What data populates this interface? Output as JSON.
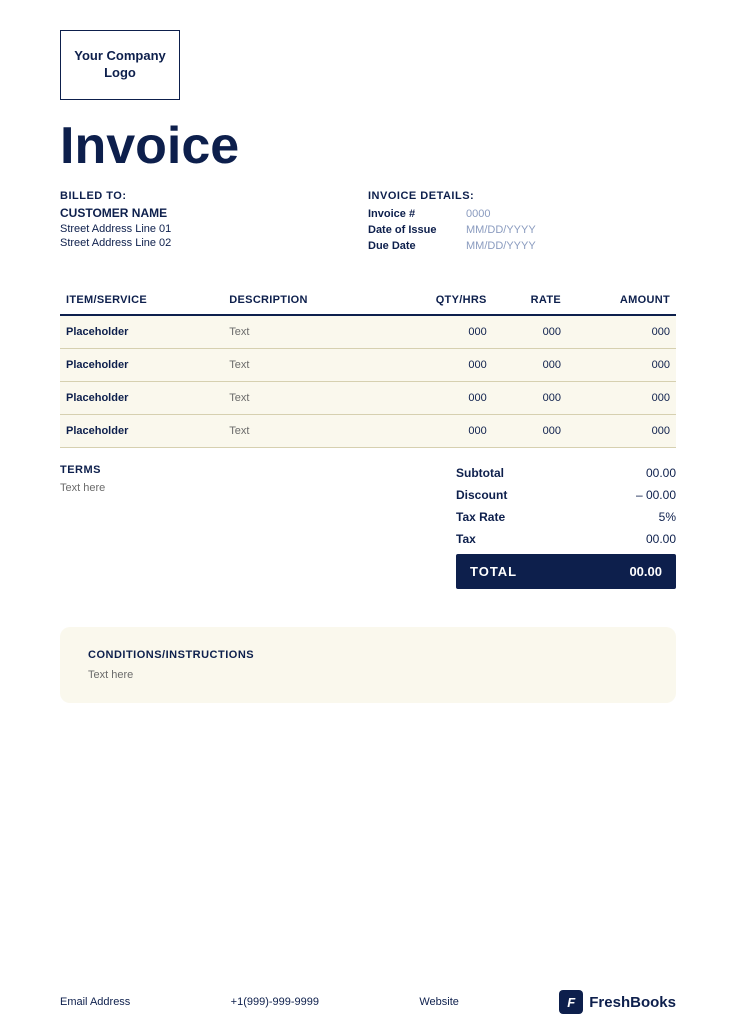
{
  "logo": {
    "text": "Your Company Logo"
  },
  "title": "Invoice",
  "billed_to": {
    "label": "BILLED TO:",
    "customer_name": "CUSTOMER NAME",
    "address_line1": "Street Address Line 01",
    "address_line2": "Street Address Line 02"
  },
  "invoice_details": {
    "label": "INVOICE DETAILS:",
    "rows": [
      {
        "key": "Invoice #",
        "value": "0000"
      },
      {
        "key": "Date of Issue",
        "value": "MM/DD/YYYY"
      },
      {
        "key": "Due Date",
        "value": "MM/DD/YYYY"
      }
    ]
  },
  "table": {
    "headers": [
      "ITEM/SERVICE",
      "DESCRIPTION",
      "QTY/HRS",
      "RATE",
      "AMOUNT"
    ],
    "rows": [
      {
        "item": "Placeholder",
        "desc": "Text",
        "qty": "000",
        "rate": "000",
        "amount": "000"
      },
      {
        "item": "Placeholder",
        "desc": "Text",
        "qty": "000",
        "rate": "000",
        "amount": "000"
      },
      {
        "item": "Placeholder",
        "desc": "Text",
        "qty": "000",
        "rate": "000",
        "amount": "000"
      },
      {
        "item": "Placeholder",
        "desc": "Text",
        "qty": "000",
        "rate": "000",
        "amount": "000"
      }
    ]
  },
  "terms": {
    "label": "TERMS",
    "text": "Text here"
  },
  "totals": {
    "subtotal_label": "Subtotal",
    "subtotal_value": "00.00",
    "discount_label": "Discount",
    "discount_value": "– 00.00",
    "tax_rate_label": "Tax Rate",
    "tax_rate_value": "5%",
    "tax_label": "Tax",
    "tax_value": "00.00",
    "total_label": "TOTAL",
    "total_value": "00.00"
  },
  "conditions": {
    "label": "CONDITIONS/INSTRUCTIONS",
    "text": "Text here"
  },
  "footer": {
    "email": "Email Address",
    "phone": "+1(999)-999-9999",
    "website": "Website",
    "brand": "FreshBooks",
    "brand_icon": "F"
  }
}
